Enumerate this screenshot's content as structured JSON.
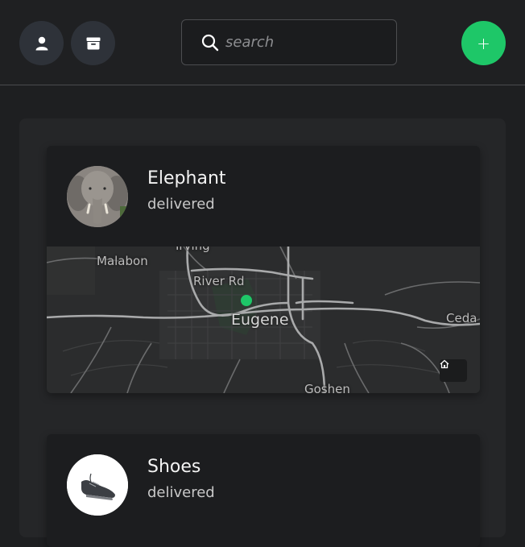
{
  "header": {
    "search_placeholder": "search",
    "add_label": "+"
  },
  "items": [
    {
      "name": "Elephant",
      "status": "delivered",
      "map": {
        "labels": {
          "irving": "Irving",
          "malabon": "Malabon",
          "river_rd": "River Rd",
          "eugene": "Eugene",
          "cedar": "Ceda",
          "goshen": "Goshen"
        }
      }
    },
    {
      "name": "Shoes",
      "status": "delivered"
    }
  ],
  "colors": {
    "accent": "#1ec768",
    "background": "#1e1f21",
    "card": "#1c1d1f",
    "panel": "#252628"
  },
  "icons": {
    "profile": "user-icon",
    "archive": "archive-icon",
    "search": "search-icon",
    "home": "home-icon"
  }
}
